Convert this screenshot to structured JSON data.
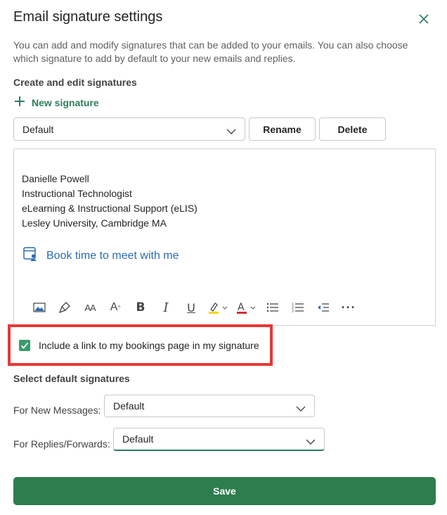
{
  "dialog": {
    "title": "Email signature settings",
    "description": "You can add and modify signatures that can be added to your emails. You can also choose which signature to add by default to your new emails and replies."
  },
  "create_section": {
    "heading": "Create and edit signatures",
    "new_signature_label": "New signature",
    "signature_select_value": "Default",
    "rename_label": "Rename",
    "delete_label": "Delete"
  },
  "editor": {
    "signature_lines": [
      "Danielle Powell",
      "Instructional Technologist",
      "eLearning & Instructional Support (eLIS)",
      "Lesley University, Cambridge MA"
    ],
    "booking_link_text": "Book time to meet with me",
    "toolbar": {
      "bold_glyph": "B",
      "italic_glyph": "I",
      "underline_glyph": "U",
      "more_glyph": "···",
      "font_size_glyph": "AA",
      "grow_font_glyph": "A"
    }
  },
  "booking_option": {
    "checked": true,
    "label": "Include a link to my bookings page in my signature"
  },
  "defaults_section": {
    "heading": "Select default signatures",
    "new_messages_label": "For New Messages:",
    "new_messages_value": "Default",
    "replies_label": "For Replies/Forwards:",
    "replies_value": "Default"
  },
  "save_label": "Save",
  "colors": {
    "accent_green": "#2e7d4f",
    "link_blue": "#2b6cb0",
    "annotation_red": "#e53935",
    "highlighter_yellow": "#f5d800",
    "font_color_red": "#d32f2f"
  }
}
